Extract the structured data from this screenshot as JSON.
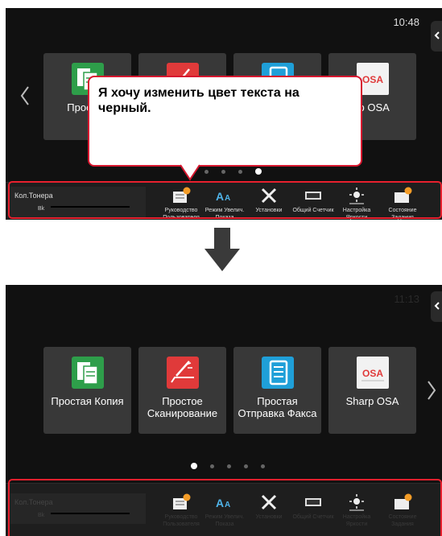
{
  "top_screen": {
    "clock": "10:48",
    "tiles": [
      {
        "label": "Простая",
        "icon": "copy-icon"
      },
      {
        "label": "",
        "icon": "scan-icon"
      },
      {
        "label": "",
        "icon": "fax-icon"
      },
      {
        "label": "rp OSA",
        "icon": "osa-icon"
      }
    ],
    "callout_text": "Я хочу изменить цвет текста на черный.",
    "toner_title": "Кол.Тонера",
    "toner_bk": "Bk",
    "taskbar": [
      {
        "label": "Руководство Пользователя",
        "icon": "user-guide-icon"
      },
      {
        "label": "Режим Увелич. Показа",
        "icon": "zoom-mode-icon"
      },
      {
        "label": "Установки",
        "icon": "settings-tools-icon"
      },
      {
        "label": "Общий Счетчик",
        "icon": "counter-icon"
      },
      {
        "label": "Настройка Яркости",
        "icon": "brightness-icon"
      },
      {
        "label": "Состояние Задания",
        "icon": "job-status-icon"
      }
    ]
  },
  "bottom_screen": {
    "clock": "11:13",
    "tiles": [
      {
        "label": "Простая Копия",
        "icon": "copy-icon"
      },
      {
        "label": "Простое Сканирование",
        "icon": "scan-icon"
      },
      {
        "label": "Простая Отправка Факса",
        "icon": "fax-icon"
      },
      {
        "label": "Sharp OSA",
        "icon": "osa-icon"
      }
    ],
    "toner_title": "Кол.Тонера",
    "toner_bk": "Bk",
    "taskbar": [
      {
        "label": "Руководство Пользователя",
        "icon": "user-guide-icon"
      },
      {
        "label": "Режим Увелич. Показа",
        "icon": "zoom-mode-icon"
      },
      {
        "label": "Установки",
        "icon": "settings-tools-icon"
      },
      {
        "label": "Общий Счетчик",
        "icon": "counter-icon"
      },
      {
        "label": "Настройка Яркости",
        "icon": "brightness-icon"
      },
      {
        "label": "Состояние Задания",
        "icon": "job-status-icon"
      }
    ]
  },
  "colors": {
    "highlight_red": "#e8202e",
    "copy_green": "#2e9e4a",
    "scan_red": "#e03a3a",
    "fax_blue": "#1f9fd8"
  }
}
